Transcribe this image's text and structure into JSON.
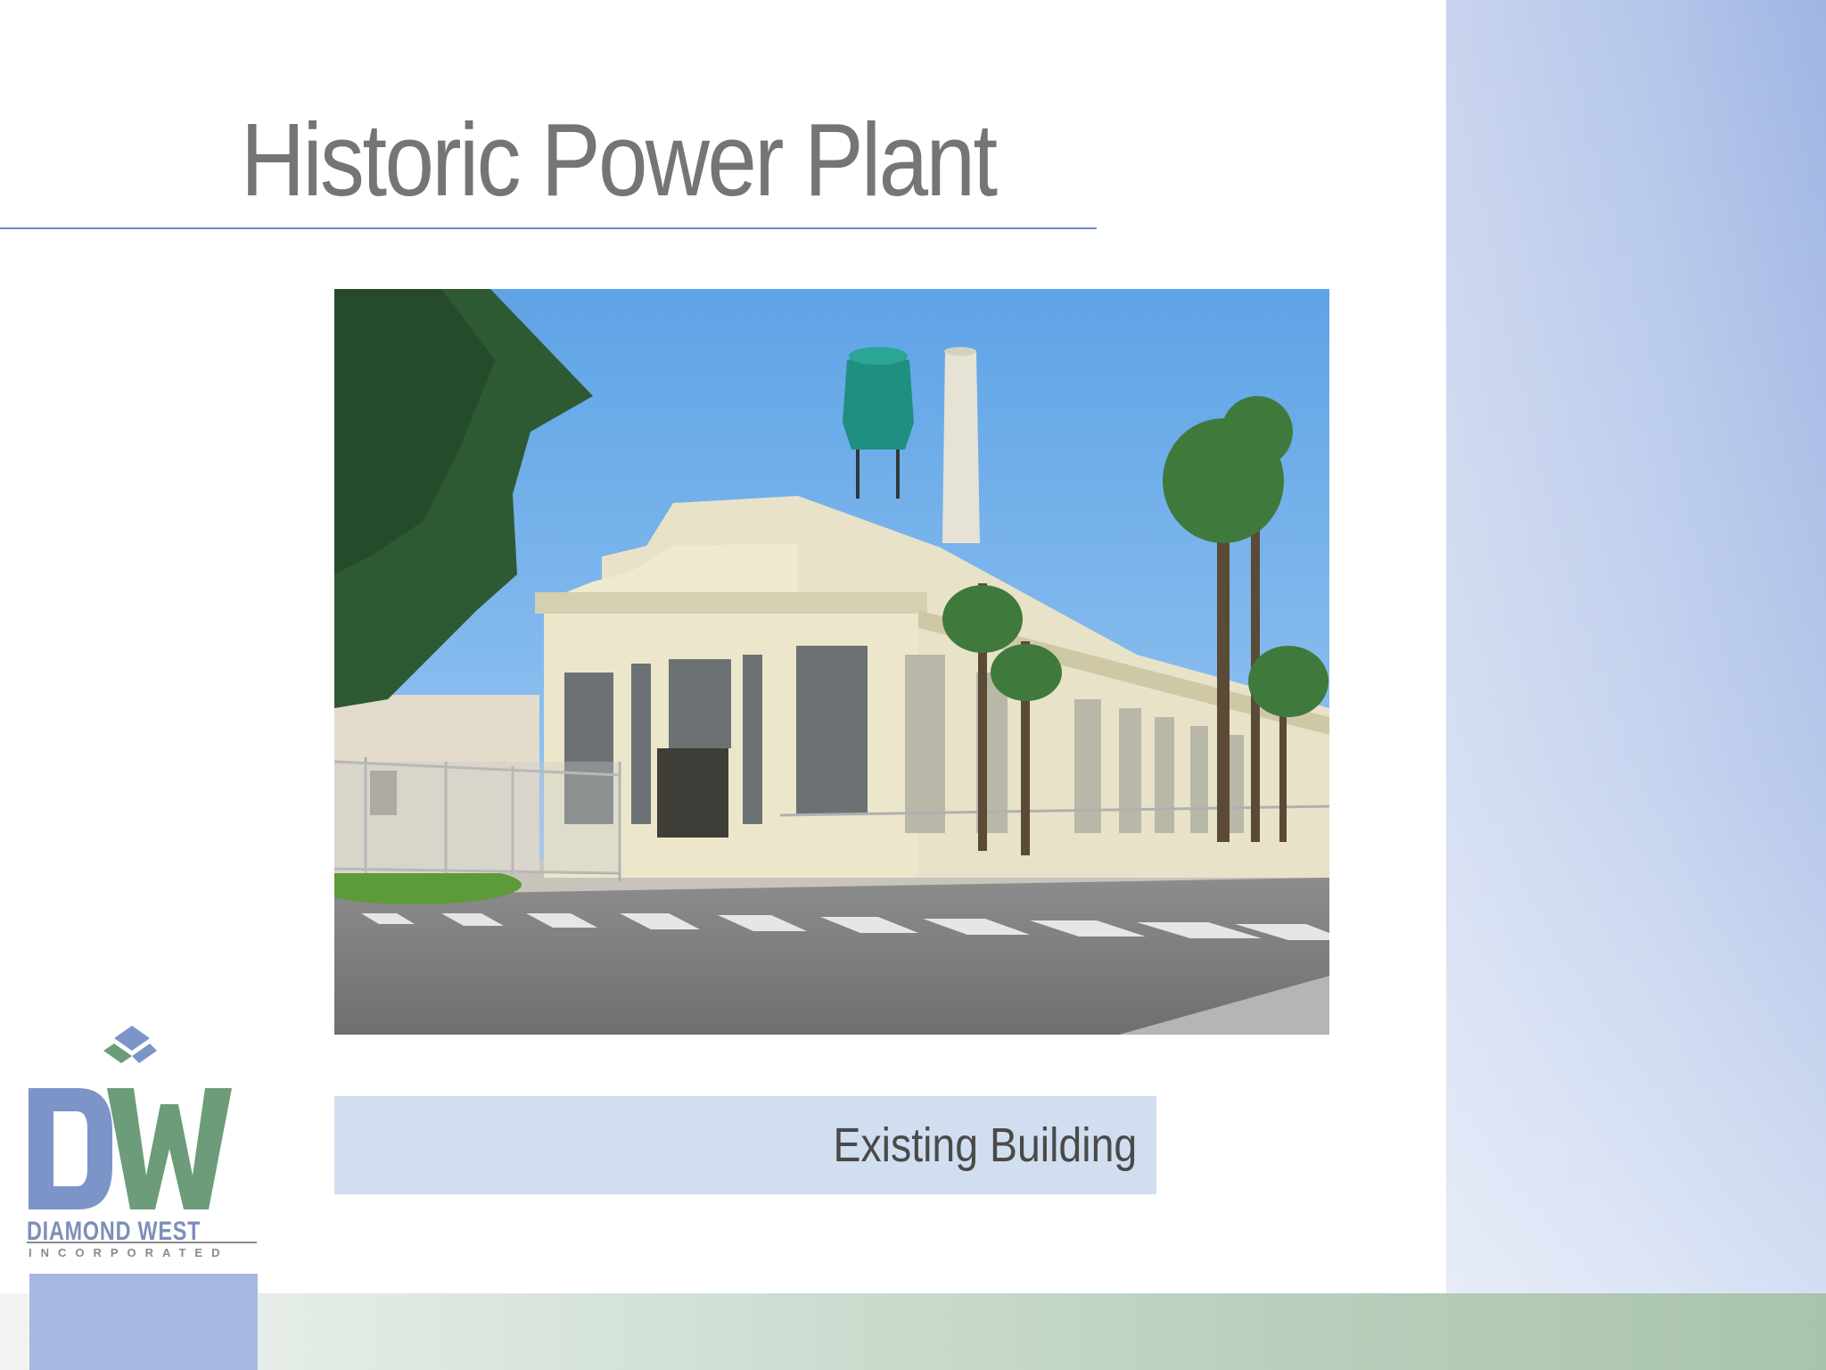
{
  "slide": {
    "title": "Historic Power Plant",
    "caption": "Existing Building"
  },
  "logo": {
    "monogram": "DW",
    "name": "DIAMOND WEST",
    "subtitle": "INCORPORATED"
  },
  "photo": {
    "icon": "historic-power-plant-photo"
  },
  "colors": {
    "title": "#757575",
    "rule": "#6d8fc4",
    "caption_bg": "#d1deef",
    "side_panel": "#b4c6ea",
    "bottom_band": "#b9cfbd",
    "logo_blue": "#7d94c9",
    "logo_green": "#6c9c79"
  }
}
